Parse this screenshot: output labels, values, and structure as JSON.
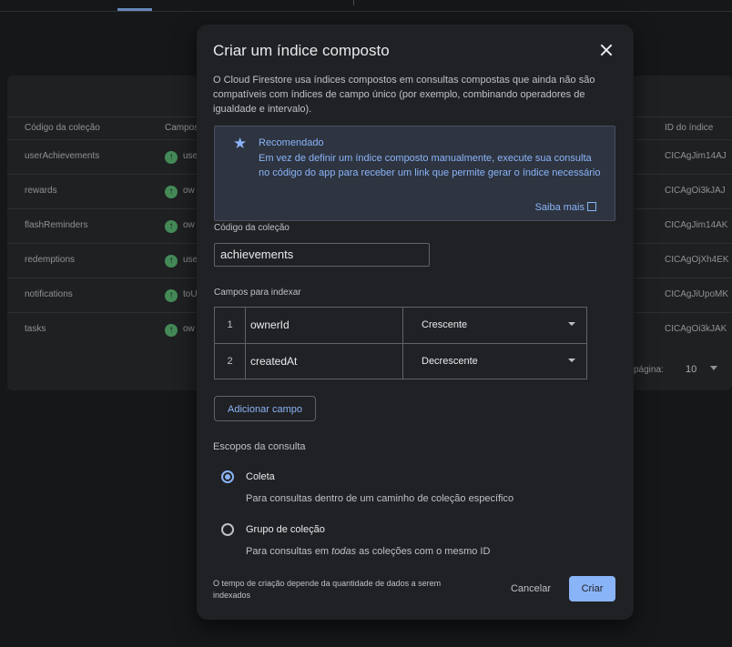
{
  "background_table": {
    "columns": {
      "collection": "Código da coleção",
      "fields": "Campos",
      "index_id": "ID do índice"
    },
    "rows": [
      {
        "collection": "userAchievements",
        "fields": "use",
        "index_id": "CICAgJim14AJ"
      },
      {
        "collection": "rewards",
        "fields": "ow",
        "index_id": "CICAgOi3kJAJ"
      },
      {
        "collection": "flashReminders",
        "fields": "ow",
        "index_id": "CICAgJim14AK"
      },
      {
        "collection": "redemptions",
        "fields": "use",
        "index_id": "CICAgOjXh4EK"
      },
      {
        "collection": "notifications",
        "fields": "toU",
        "index_id": "CICAgJiUpoMK"
      },
      {
        "collection": "tasks",
        "fields": "ow",
        "index_id": "CICAgOi3kJAK"
      }
    ],
    "status_icon": "arrow-up",
    "pager": {
      "label": "página:",
      "value": "10"
    }
  },
  "dialog": {
    "title": "Criar um índice composto",
    "description": "O Cloud Firestore usa índices compostos em consultas compostas que ainda não são compatíveis com índices de campo único (por exemplo, combinando operadores de igualdade e intervalo).",
    "recommendation": {
      "icon": "star",
      "title": "Recomendado",
      "body": "Em vez de definir um índice composto manualmente, execute sua consulta no código do app para receber um link que permite gerar o índice necessário",
      "link": "Saiba mais"
    },
    "collection_label": "Código da coleção",
    "collection_value": "achievements",
    "fields_label": "Campos para indexar",
    "fields": [
      {
        "num": "1",
        "name": "ownerId",
        "order": "Crescente"
      },
      {
        "num": "2",
        "name": "createdAt",
        "order": "Decrescente"
      }
    ],
    "add_field": "Adicionar campo",
    "scopes_label": "Escopos da consulta",
    "scope_options": [
      {
        "title": "Coleta",
        "desc": "Para consultas dentro de um caminho de coleção específico",
        "selected": true
      },
      {
        "title": "Grupo de coleção",
        "desc_pre": "Para consultas em ",
        "desc_em": "todas",
        "desc_post": " as coleções com o mesmo ID",
        "selected": false
      }
    ],
    "footnote": "O tempo de criação depende da quantidade de dados a serem indexados",
    "cancel": "Cancelar",
    "create": "Criar"
  },
  "colors": {
    "accent": "#8ab4f8",
    "dialog_bg": "#202124",
    "success": "#5bb974"
  }
}
